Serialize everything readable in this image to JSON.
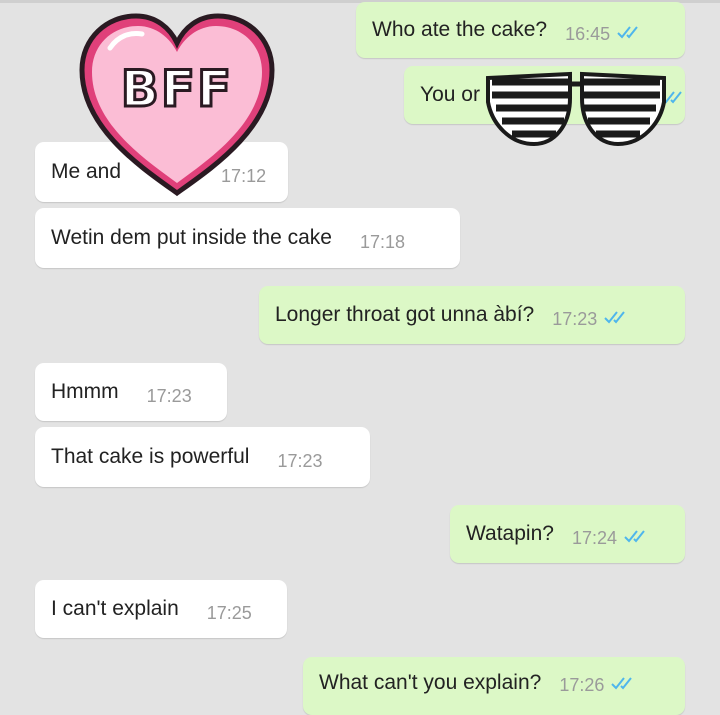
{
  "sticker": {
    "label": "BFF"
  },
  "messages": [
    {
      "dir": "out",
      "text": "Who ate the cake?",
      "time": "16:45"
    },
    {
      "dir": "out",
      "text": "You or",
      "time": ""
    },
    {
      "dir": "in",
      "text": "Me and",
      "time": "17:12"
    },
    {
      "dir": "in",
      "text": "Wetin dem put inside the cake",
      "time": "17:18"
    },
    {
      "dir": "out",
      "text": "Longer throat got unna àbí?",
      "time": "17:23"
    },
    {
      "dir": "in",
      "text": "Hmmm",
      "time": "17:23"
    },
    {
      "dir": "in",
      "text": "That cake is powerful",
      "time": "17:23"
    },
    {
      "dir": "out",
      "text": "Watapin?",
      "time": "17:24"
    },
    {
      "dir": "in",
      "text": "I can't explain",
      "time": "17:25"
    },
    {
      "dir": "out",
      "text": "What can't you explain?",
      "time": "17:26"
    }
  ],
  "colors": {
    "incoming": "#ffffff",
    "outgoing": "#dcf8c6",
    "read_ticks": "#4fb6ec",
    "background": "#e3e3e3"
  },
  "icons": {
    "read_receipt": "double-check-icon",
    "sticker": "heart-bff-icon",
    "overlay": "shutter-shades-icon"
  }
}
